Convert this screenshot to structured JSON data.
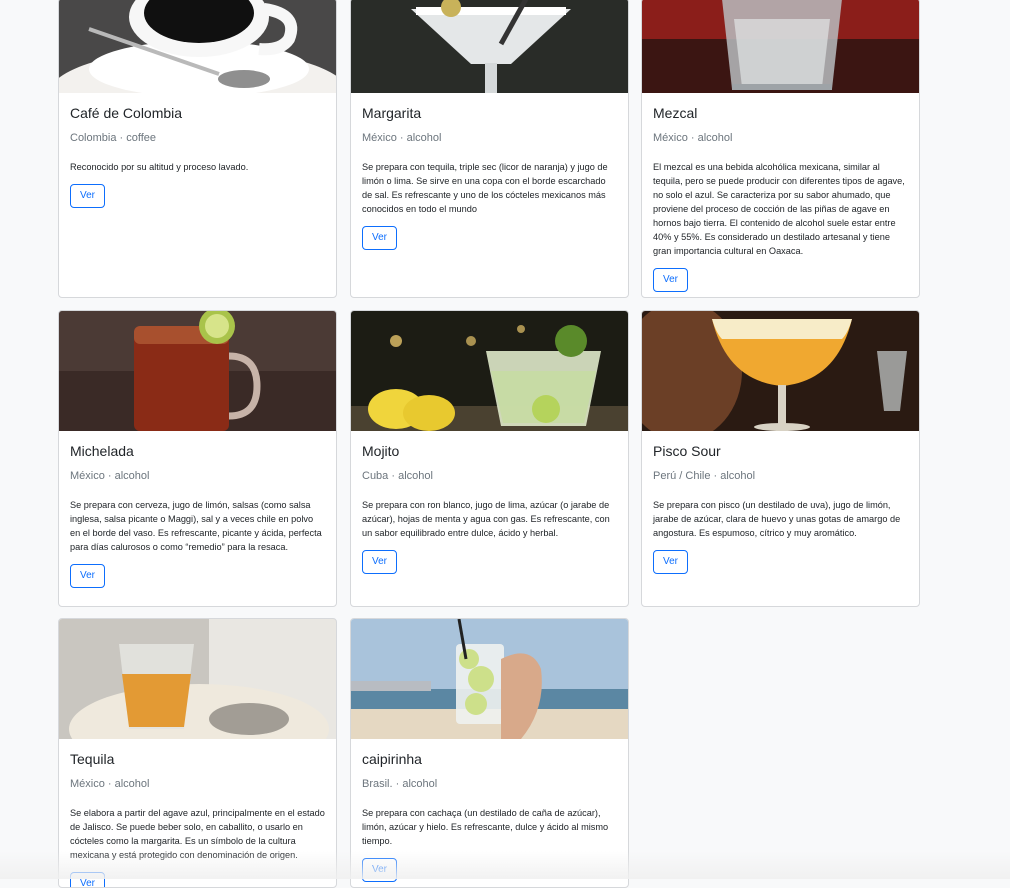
{
  "cards": [
    {
      "title": "Café de Colombia",
      "subtitle": "Colombia · coffee",
      "text": "Reconocido por su altitud y proceso lavado.",
      "button": "Ver",
      "image": "coffee-cup-photo"
    },
    {
      "title": "Margarita",
      "subtitle": "México · alcohol",
      "text": "Se prepara con tequila, triple sec (licor de naranja) y jugo de limón o lima. Se sirve en una copa con el borde escarchado de sal. Es refrescante y uno de los cócteles mexicanos más conocidos en todo el mundo",
      "button": "Ver",
      "image": "margarita-glass-photo"
    },
    {
      "title": "Mezcal",
      "subtitle": "México · alcohol",
      "text": "El mezcal es una bebida alcohólica mexicana, similar al tequila, pero se puede producir con diferentes tipos de agave, no solo el azul. Se caracteriza por su sabor ahumado, que proviene del proceso de cocción de las piñas de agave en hornos bajo tierra. El contenido de alcohol suele estar entre 40% y 55%. Es considerado un destilado artesanal y tiene gran importancia cultural en Oaxaca.",
      "button": "Ver",
      "image": "mezcal-glass-photo"
    },
    {
      "title": "Michelada",
      "subtitle": "México · alcohol",
      "text": "Se prepara con cerveza, jugo de limón, salsas (como salsa inglesa, salsa picante o Maggi), sal y a veces chile en polvo en el borde del vaso. Es refrescante, picante y ácida, perfecta para días calurosos o como “remedio” para la resaca.",
      "button": "Ver",
      "image": "michelada-mug-photo"
    },
    {
      "title": "Mojito",
      "subtitle": "Cuba · alcohol",
      "text": "Se prepara con ron blanco, jugo de lima, azúcar (o jarabe de azúcar), hojas de menta y agua con gas. Es refrescante, con un sabor equilibrado entre dulce, ácido y herbal.",
      "button": "Ver",
      "image": "mojito-glass-photo"
    },
    {
      "title": "Pisco Sour",
      "subtitle": "Perú / Chile · alcohol",
      "text": "Se prepara con pisco (un destilado de uva), jugo de limón, jarabe de azúcar, clara de huevo y unas gotas de amargo de angostura. Es espumoso, cítrico y muy aromático.",
      "button": "Ver",
      "image": "pisco-sour-coupe-photo"
    },
    {
      "title": "Tequila",
      "subtitle": "México · alcohol",
      "text": "Se elabora a partir del agave azul, principalmente en el estado de Jalisco. Se puede beber solo, en caballito, o usarlo en cócteles como la margarita. Es un símbolo de la cultura mexicana y está protegido con denominación de origen.",
      "button": "Ver",
      "image": "tequila-glass-photo"
    },
    {
      "title": "caipirinha",
      "subtitle": "Brasil. · alcohol",
      "text": "Se prepara con cachaça (un destilado de caña de azúcar), limón, azúcar y hielo. Es refrescante, dulce y ácido al mismo tiempo.",
      "button": "Ver",
      "image": "caipirinha-beach-photo"
    }
  ]
}
